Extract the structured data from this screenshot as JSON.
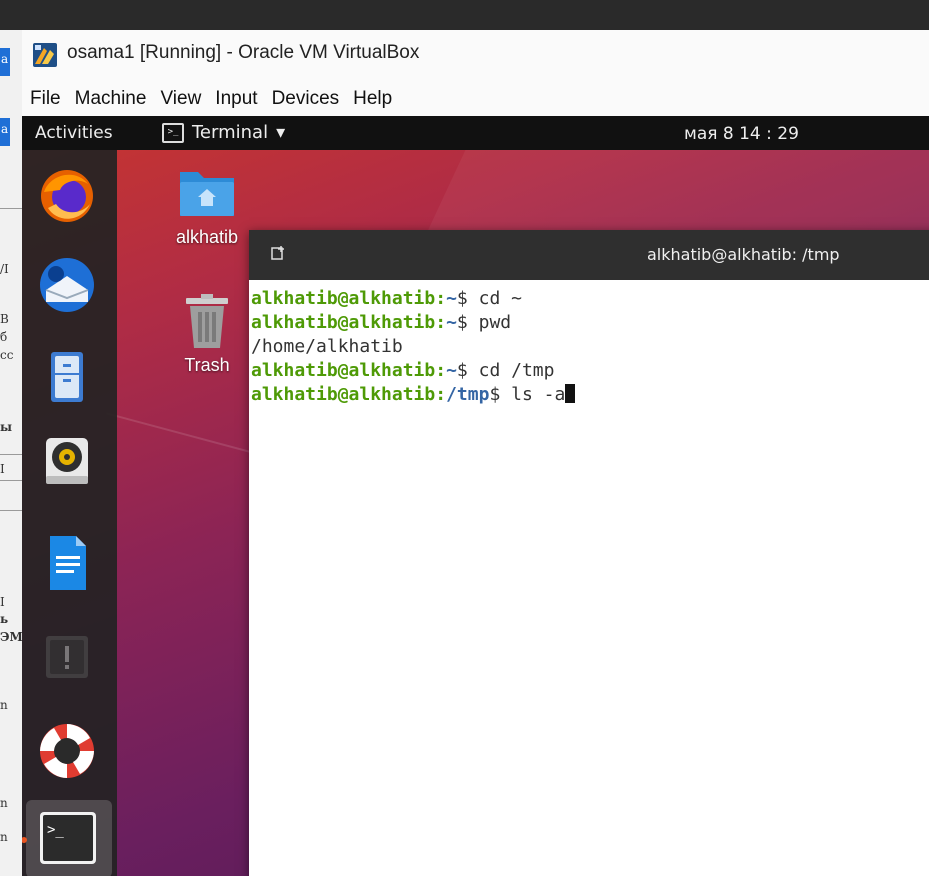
{
  "vbox": {
    "title": "osama1 [Running] - Oracle VM VirtualBox",
    "menu": [
      "File",
      "Machine",
      "View",
      "Input",
      "Devices",
      "Help"
    ]
  },
  "topbar": {
    "activities": "Activities",
    "app": "Terminal",
    "app_arrow": "▾",
    "clock": "мая 8  14 : 29"
  },
  "desktop": {
    "home_label": "alkhatib",
    "trash_label": "Trash"
  },
  "dock": {
    "items": [
      "firefox-icon",
      "thunderbird-icon",
      "files-icon",
      "rhythmbox-icon",
      "writer-icon",
      "software-icon",
      "help-icon",
      "terminal-icon"
    ]
  },
  "terminal": {
    "title": "alkhatib@alkhatib: /tmp",
    "lines": [
      {
        "user": "alkhatib@alkhatib",
        "sep": ":",
        "path": "~",
        "dollar": "$",
        "cmd": " cd ~"
      },
      {
        "user": "alkhatib@alkhatib",
        "sep": ":",
        "path": "~",
        "dollar": "$",
        "cmd": " pwd"
      },
      {
        "output": "/home/alkhatib"
      },
      {
        "user": "alkhatib@alkhatib",
        "sep": ":",
        "path": "~",
        "dollar": "$",
        "cmd": " cd /tmp"
      },
      {
        "user": "alkhatib@alkhatib",
        "sep": ":",
        "path": "/tmp",
        "dollar": "$",
        "cmd": " ls -a"
      }
    ]
  },
  "host": {
    "fragments": [
      "a",
      "a",
      "/I",
      "B",
      "б",
      "cc",
      "ы",
      "I",
      "I",
      "ь",
      "ЭМ",
      "n",
      "n",
      "n"
    ]
  },
  "colors": {
    "prompt_user": "#4e9a06",
    "prompt_path": "#3465a4",
    "topbar": "#111111",
    "terminal_header": "#2f2f2f"
  }
}
